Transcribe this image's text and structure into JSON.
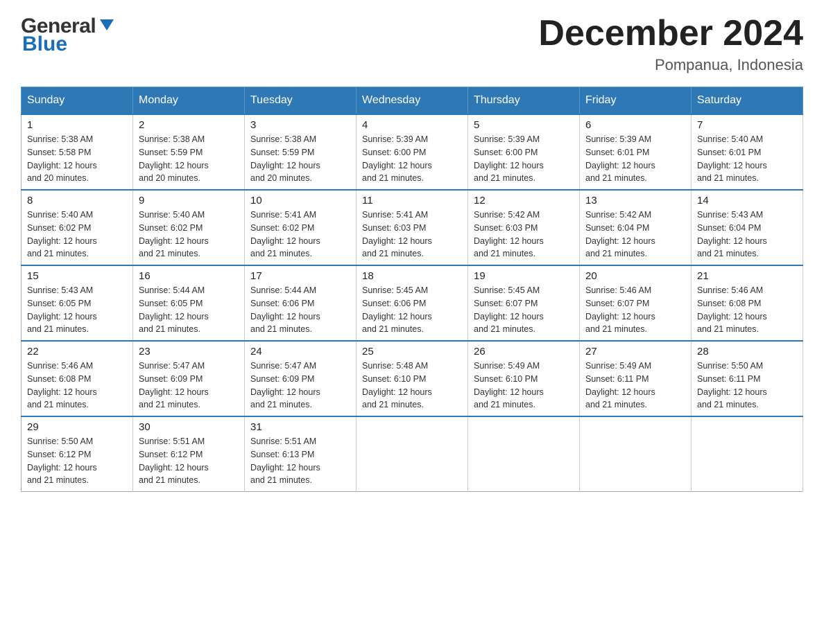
{
  "header": {
    "logo_general": "General",
    "logo_blue": "Blue",
    "month_title": "December 2024",
    "location": "Pompanua, Indonesia"
  },
  "weekdays": [
    "Sunday",
    "Monday",
    "Tuesday",
    "Wednesday",
    "Thursday",
    "Friday",
    "Saturday"
  ],
  "weeks": [
    [
      {
        "day": "1",
        "sunrise": "5:38 AM",
        "sunset": "5:58 PM",
        "daylight": "12 hours and 20 minutes."
      },
      {
        "day": "2",
        "sunrise": "5:38 AM",
        "sunset": "5:59 PM",
        "daylight": "12 hours and 20 minutes."
      },
      {
        "day": "3",
        "sunrise": "5:38 AM",
        "sunset": "5:59 PM",
        "daylight": "12 hours and 20 minutes."
      },
      {
        "day": "4",
        "sunrise": "5:39 AM",
        "sunset": "6:00 PM",
        "daylight": "12 hours and 21 minutes."
      },
      {
        "day": "5",
        "sunrise": "5:39 AM",
        "sunset": "6:00 PM",
        "daylight": "12 hours and 21 minutes."
      },
      {
        "day": "6",
        "sunrise": "5:39 AM",
        "sunset": "6:01 PM",
        "daylight": "12 hours and 21 minutes."
      },
      {
        "day": "7",
        "sunrise": "5:40 AM",
        "sunset": "6:01 PM",
        "daylight": "12 hours and 21 minutes."
      }
    ],
    [
      {
        "day": "8",
        "sunrise": "5:40 AM",
        "sunset": "6:02 PM",
        "daylight": "12 hours and 21 minutes."
      },
      {
        "day": "9",
        "sunrise": "5:40 AM",
        "sunset": "6:02 PM",
        "daylight": "12 hours and 21 minutes."
      },
      {
        "day": "10",
        "sunrise": "5:41 AM",
        "sunset": "6:02 PM",
        "daylight": "12 hours and 21 minutes."
      },
      {
        "day": "11",
        "sunrise": "5:41 AM",
        "sunset": "6:03 PM",
        "daylight": "12 hours and 21 minutes."
      },
      {
        "day": "12",
        "sunrise": "5:42 AM",
        "sunset": "6:03 PM",
        "daylight": "12 hours and 21 minutes."
      },
      {
        "day": "13",
        "sunrise": "5:42 AM",
        "sunset": "6:04 PM",
        "daylight": "12 hours and 21 minutes."
      },
      {
        "day": "14",
        "sunrise": "5:43 AM",
        "sunset": "6:04 PM",
        "daylight": "12 hours and 21 minutes."
      }
    ],
    [
      {
        "day": "15",
        "sunrise": "5:43 AM",
        "sunset": "6:05 PM",
        "daylight": "12 hours and 21 minutes."
      },
      {
        "day": "16",
        "sunrise": "5:44 AM",
        "sunset": "6:05 PM",
        "daylight": "12 hours and 21 minutes."
      },
      {
        "day": "17",
        "sunrise": "5:44 AM",
        "sunset": "6:06 PM",
        "daylight": "12 hours and 21 minutes."
      },
      {
        "day": "18",
        "sunrise": "5:45 AM",
        "sunset": "6:06 PM",
        "daylight": "12 hours and 21 minutes."
      },
      {
        "day": "19",
        "sunrise": "5:45 AM",
        "sunset": "6:07 PM",
        "daylight": "12 hours and 21 minutes."
      },
      {
        "day": "20",
        "sunrise": "5:46 AM",
        "sunset": "6:07 PM",
        "daylight": "12 hours and 21 minutes."
      },
      {
        "day": "21",
        "sunrise": "5:46 AM",
        "sunset": "6:08 PM",
        "daylight": "12 hours and 21 minutes."
      }
    ],
    [
      {
        "day": "22",
        "sunrise": "5:46 AM",
        "sunset": "6:08 PM",
        "daylight": "12 hours and 21 minutes."
      },
      {
        "day": "23",
        "sunrise": "5:47 AM",
        "sunset": "6:09 PM",
        "daylight": "12 hours and 21 minutes."
      },
      {
        "day": "24",
        "sunrise": "5:47 AM",
        "sunset": "6:09 PM",
        "daylight": "12 hours and 21 minutes."
      },
      {
        "day": "25",
        "sunrise": "5:48 AM",
        "sunset": "6:10 PM",
        "daylight": "12 hours and 21 minutes."
      },
      {
        "day": "26",
        "sunrise": "5:49 AM",
        "sunset": "6:10 PM",
        "daylight": "12 hours and 21 minutes."
      },
      {
        "day": "27",
        "sunrise": "5:49 AM",
        "sunset": "6:11 PM",
        "daylight": "12 hours and 21 minutes."
      },
      {
        "day": "28",
        "sunrise": "5:50 AM",
        "sunset": "6:11 PM",
        "daylight": "12 hours and 21 minutes."
      }
    ],
    [
      {
        "day": "29",
        "sunrise": "5:50 AM",
        "sunset": "6:12 PM",
        "daylight": "12 hours and 21 minutes."
      },
      {
        "day": "30",
        "sunrise": "5:51 AM",
        "sunset": "6:12 PM",
        "daylight": "12 hours and 21 minutes."
      },
      {
        "day": "31",
        "sunrise": "5:51 AM",
        "sunset": "6:13 PM",
        "daylight": "12 hours and 21 minutes."
      },
      null,
      null,
      null,
      null
    ]
  ],
  "labels": {
    "sunrise": "Sunrise:",
    "sunset": "Sunset:",
    "daylight": "Daylight:"
  }
}
